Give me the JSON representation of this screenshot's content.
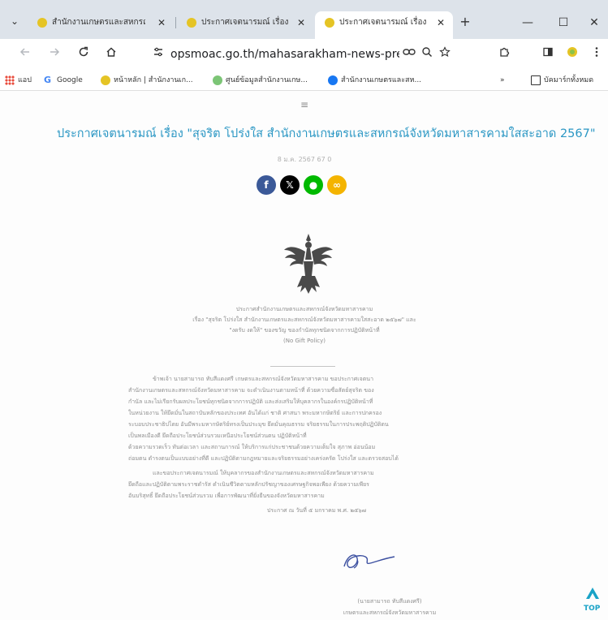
{
  "browser": {
    "tabs": [
      {
        "title": "สำนักงานเกษตรและสหกรณ์"
      },
      {
        "title": "ประกาศเจตนารมณ์ เรื่อง"
      },
      {
        "title": "ประกาศเจตนารมณ์ เรื่อง"
      }
    ],
    "tab_menu_glyph": "⌄",
    "close_glyph": "✕",
    "new_tab_glyph": "+",
    "window_glyphs": {
      "minimize": "—",
      "maximize": "☐",
      "close": "✕"
    },
    "url": "opsmoac.go.th/mahasarakham-news-preview-4618...",
    "bookmarks": [
      {
        "label": "แอป"
      },
      {
        "label": "Google"
      },
      {
        "label": "หน้าหลัก | สำนักงานเก..."
      },
      {
        "label": "ศูนย์ข้อมูลสำนักงานเกษ..."
      },
      {
        "label": "สำนักงานเกษตรและสห..."
      },
      {
        "label": "บัคมาร์กทั้งหมด"
      }
    ],
    "more_bookmarks_glyph": "»"
  },
  "page": {
    "menu_glyph": "≡",
    "title": "ประกาศเจตนารมณ์ เรื่อง \"สุจริต โปร่งใส สำนักงานเกษตรและสหกรณ์จังหวัดมหาสารคามใสสะอาด 2567\"",
    "meta": "8 ม.ค. 2567   67   0",
    "share_glyphs": {
      "facebook": "f",
      "x": "𝕏",
      "line": "●",
      "link": "∞"
    },
    "doc": {
      "heading": [
        "ประกาศสำนักงานเกษตรและสหกรณ์จังหวัดมหาสารคาม",
        "เรื่อง \"สุจริต โปร่งใส สำนักงานเกษตรและสหกรณ์จังหวัดมหาสารคามใสสะอาด ๒๕๖๗\" และ",
        "\"งดรับ งดให้\" ของขวัญ ของกำนัลทุกชนิดจากการปฏิบัติหน้าที่",
        "(No Gift Policy)"
      ],
      "body": [
        "ข้าพเจ้า นายสามารถ ทับสีแดงศรี เกษตรและสหกรณ์จังหวัดมหาสารคาม ขอประกาศเจตนา",
        "สำนักงานเกษตรและสหกรณ์จังหวัดมหาสารคาม จะดำเนินงานตามหน้าที่ ด้วยความซื่อสัตย์สุจริต ของ",
        "กำนัล และไม่เรียกรับผลประโยชน์ทุกชนิดจากการปฏิบัติ และส่งเสริมให้บุคลากรในองค์กรปฏิบัติหน้าที่",
        "ในหน่วยงาน ให้ยึดมั่นในสถาบันหลักของประเทศ อันได้แก่ ชาติ ศาสนา พระมหากษัตริย์ และการปกครอง",
        "ระบอบประชาธิปไตย อันมีพระมหากษัตริย์ทรงเป็นประมุข ยึดมั่นคุณธรรม จริยธรรมในการประพฤติปฏิบัติตน",
        "เป็นพลเมืองดี ยึดถือประโยชน์ส่วนรวมเหนือประโยชน์ส่วนตน ปฏิบัติหน้าที่",
        "ด้วยความรวดเร็ว ทันต่อเวลา และสถานการณ์ ให้บริการแก่ประชาชนด้วยความเต็มใจ สุภาพ อ่อนน้อม",
        "ถ่อมตน ดำรงตนเป็นแบบอย่างที่ดี และปฏิบัติตามกฎหมายและจริยธรรมอย่างเคร่งครัด โปร่งใส และตรวจสอบได้",
        "และขอประกาศเจตนารมณ์ ให้บุคลากรของสำนักงานเกษตรและสหกรณ์จังหวัดมหาสารคาม",
        "ยึดถือและปฏิบัติตามพระราชดำรัส ดำเนินชีวิตตามหลักปรัชญาของเศรษฐกิจพอเพียง ด้วยความเพียร",
        "อันบริสุทธิ์ ยึดถือประโยชน์ส่วนรวม เพื่อการพัฒนาที่ยั่งยืนของจังหวัดมหาสารคาม"
      ],
      "date_line": "ประกาศ ณ วันที่ ๕ มกราคม พ.ศ. ๒๕๖๗",
      "signer_name": "(นายสามารถ ทับสีแดงศรี)",
      "signer_position": "เกษตรและสหกรณ์จังหวัดมหาสารคาม"
    },
    "top_button_label": "TOP"
  },
  "colors": {
    "title": "#2b97c4",
    "facebook": "#3b5998",
    "x": "#000000",
    "line": "#00b900",
    "link": "#f4b400",
    "tab_favicon": "#e5c425"
  }
}
